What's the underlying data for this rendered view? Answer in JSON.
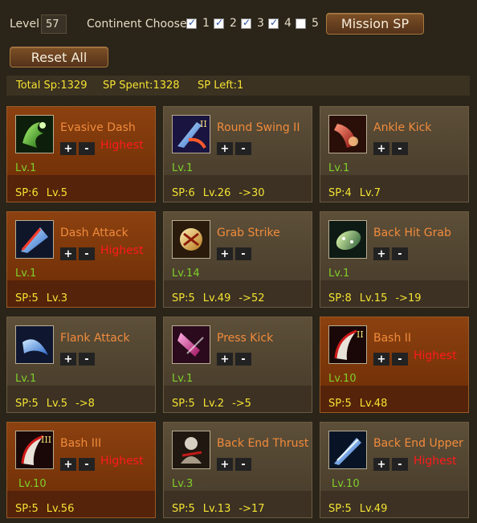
{
  "header": {
    "level_label": "Level",
    "level_value": "57",
    "continent_label": "Continent Choose:",
    "continents": [
      {
        "label": "1",
        "checked": true
      },
      {
        "label": "2",
        "checked": true
      },
      {
        "label": "3",
        "checked": true
      },
      {
        "label": "4",
        "checked": true
      },
      {
        "label": "5",
        "checked": false
      }
    ],
    "mission_sp_label": "Mission SP",
    "reset_all_label": "Reset All"
  },
  "stats": {
    "total_sp": "Total Sp:1329",
    "sp_spent": "SP Spent:1328",
    "sp_left": "SP Left:1"
  },
  "buttons": {
    "plus": "+",
    "minus": "-"
  },
  "skills": [
    {
      "name": "Evasive Dash",
      "status": "Highest",
      "level": "Lv.1",
      "sp": "SP:6",
      "req": "Lv.5",
      "next": "",
      "icon": "evasive-dash-icon"
    },
    {
      "name": "Round Swing II",
      "status": "",
      "level": "Lv.1",
      "sp": "SP:6",
      "req": "Lv.26",
      "next": "->30",
      "icon": "round-swing-icon"
    },
    {
      "name": "Ankle Kick",
      "status": "",
      "level": "Lv.1",
      "sp": "SP:4",
      "req": "Lv.7",
      "next": "",
      "icon": "ankle-kick-icon"
    },
    {
      "name": "Dash Attack",
      "status": "Highest",
      "level": "Lv.1",
      "sp": "SP:5",
      "req": "Lv.3",
      "next": "",
      "icon": "dash-attack-icon"
    },
    {
      "name": "Grab Strike",
      "status": "",
      "level": "Lv.14",
      "sp": "SP:5",
      "req": "Lv.49",
      "next": "->52",
      "icon": "grab-strike-icon"
    },
    {
      "name": "Back Hit Grab",
      "status": "",
      "level": "Lv.1",
      "sp": "SP:8",
      "req": "Lv.15",
      "next": "->19",
      "icon": "back-hit-grab-icon"
    },
    {
      "name": "Flank Attack",
      "status": "",
      "level": "Lv.1",
      "sp": "SP:5",
      "req": "Lv.5",
      "next": "->8",
      "icon": "flank-attack-icon"
    },
    {
      "name": "Press Kick",
      "status": "",
      "level": "Lv.1",
      "sp": "SP:5",
      "req": "Lv.2",
      "next": "->5",
      "icon": "press-kick-icon"
    },
    {
      "name": "Bash II",
      "status": "Highest",
      "level": "Lv.10",
      "sp": "SP:5",
      "req": "Lv.48",
      "next": "",
      "icon": "bash-2-icon"
    },
    {
      "name": "Bash III",
      "status": "Highest",
      "level": "Lv.10",
      "sp": "SP:5",
      "req": "Lv.56",
      "next": "",
      "icon": "bash-3-icon"
    },
    {
      "name": "Back End Thrust",
      "status": "",
      "level": "Lv.3",
      "sp": "SP:5",
      "req": "Lv.13",
      "next": "->17",
      "icon": "back-end-thrust-icon"
    },
    {
      "name": "Back End Upper",
      "status": "Highest",
      "level": "Lv.10",
      "sp": "SP:5",
      "req": "Lv.49",
      "next": "",
      "icon": "back-end-upper-icon"
    }
  ],
  "colors": {
    "background": "#2a2419",
    "card_brown": "#54473a",
    "card_orange": "#7e370b",
    "skill_name": "#f08b3c",
    "highest": "#ff1a1a",
    "level_green": "#7fcf2a",
    "stat_yellow": "#f4e232"
  }
}
